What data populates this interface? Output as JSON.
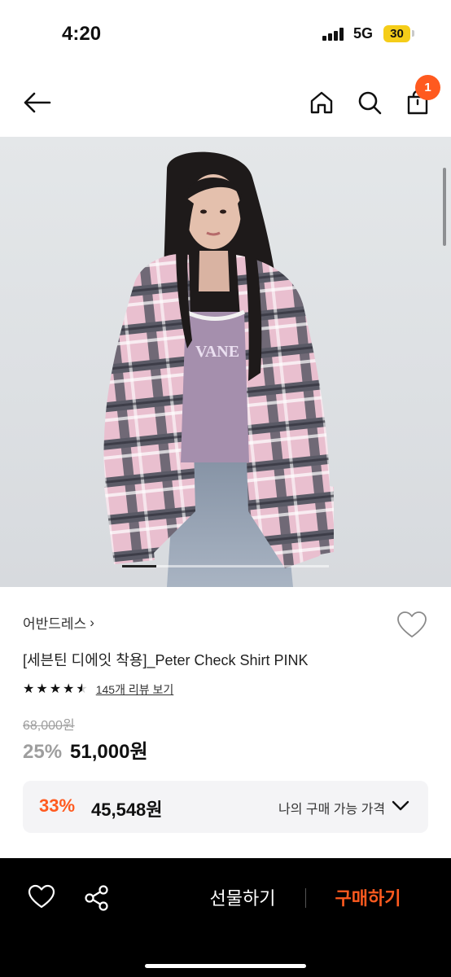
{
  "status_bar": {
    "time": "4:20",
    "network": "5G",
    "battery": "30"
  },
  "header": {
    "cart_count": "1",
    "icons": [
      "back-arrow-icon",
      "home-icon",
      "search-icon",
      "shopping-bag-icon"
    ]
  },
  "product": {
    "brand": "어반드레스",
    "brand_chevron": "›",
    "title": "[세븐틴 디에잇 착용]_Peter Check Shirt PINK",
    "rating": 4.5,
    "review_link": "145개 리뷰 보기",
    "original_price": "68,000원",
    "discount_rate": "25%",
    "sale_price": "51,000원",
    "my_discount_rate": "33%",
    "my_price": "45,548원",
    "my_price_label": "나의 구매 가능 가격",
    "image_carousel_index": 1
  },
  "bottom_bar": {
    "gift_label": "선물하기",
    "buy_label": "구매하기"
  },
  "colors": {
    "accent": "#ff5a1f",
    "battery": "#f5cd19",
    "dark": "#000000",
    "muted": "#9e9e9e",
    "panel": "#f4f4f6"
  }
}
